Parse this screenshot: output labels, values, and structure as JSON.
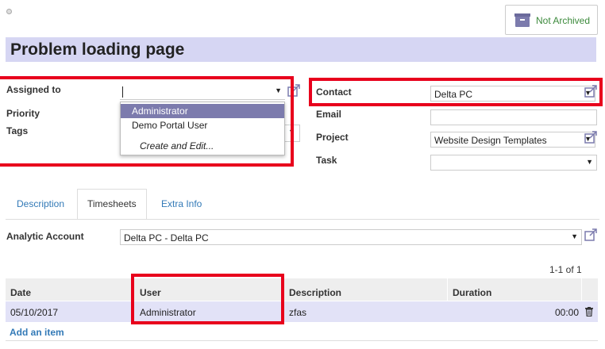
{
  "header": {
    "archive_label": "Not Archived",
    "title": "Problem loading page"
  },
  "left_fields": {
    "assigned_label": "Assigned to",
    "assigned_value": "",
    "priority_label": "Priority",
    "tags_label": "Tags"
  },
  "assigned_dropdown": {
    "items": [
      "Administrator",
      "Demo Portal User"
    ],
    "create_label": "Create and Edit..."
  },
  "right_fields": {
    "contact_label": "Contact",
    "contact_value": "Delta PC",
    "email_label": "Email",
    "email_value": "",
    "project_label": "Project",
    "project_value": "Website Design Templates",
    "task_label": "Task",
    "task_value": ""
  },
  "tabs": [
    {
      "label": "Description",
      "active": false
    },
    {
      "label": "Timesheets",
      "active": true
    },
    {
      "label": "Extra Info",
      "active": false
    }
  ],
  "timesheets": {
    "analytic_label": "Analytic Account",
    "analytic_value": "Delta PC - Delta PC",
    "pager": "1-1 of 1",
    "columns": [
      "Date",
      "User",
      "Description",
      "Duration"
    ],
    "rows": [
      {
        "date": "05/10/2017",
        "user": "Administrator",
        "description": "zfas",
        "duration": "00:00"
      }
    ],
    "add_item": "Add an item"
  },
  "colors": {
    "accent": "#7c7bad",
    "title_bg": "#d6d6f3",
    "highlight_red": "#e8001c",
    "link": "#337ab7",
    "archive_green": "#3c8a3c"
  },
  "icons": [
    "record-dot-icon",
    "archive-box-icon",
    "external-link-icon",
    "dropdown-caret-icon",
    "trash-icon"
  ]
}
